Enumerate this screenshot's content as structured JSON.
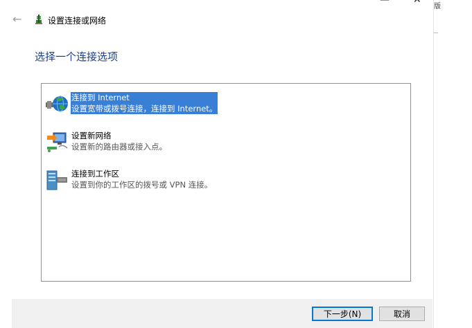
{
  "window": {
    "minimize_glyph": "—",
    "close_glyph": "✕",
    "side_fragment": "版"
  },
  "header": {
    "back_glyph": "←",
    "icon": "network-setup-icon",
    "title": "设置连接或网络"
  },
  "main": {
    "heading": "选择一个连接选项",
    "options": [
      {
        "title": "连接到 Internet",
        "desc": "设置宽带或拨号连接，连接到 Internet。",
        "icon": "globe-network-icon",
        "selected": true
      },
      {
        "title": "设置新网络",
        "desc": "设置新的路由器或接入点。",
        "icon": "new-network-icon",
        "selected": false
      },
      {
        "title": "连接到工作区",
        "desc": "设置到你的工作区的拨号或 VPN 连接。",
        "icon": "workplace-server-icon",
        "selected": false
      }
    ]
  },
  "footer": {
    "next_label": "下一步(N)",
    "cancel_label": "取消"
  },
  "colors": {
    "heading": "#1b3f8b",
    "selection": "#3a7fd6",
    "focus_border": "#0078d7",
    "footer_bg": "#f0f0f0"
  }
}
